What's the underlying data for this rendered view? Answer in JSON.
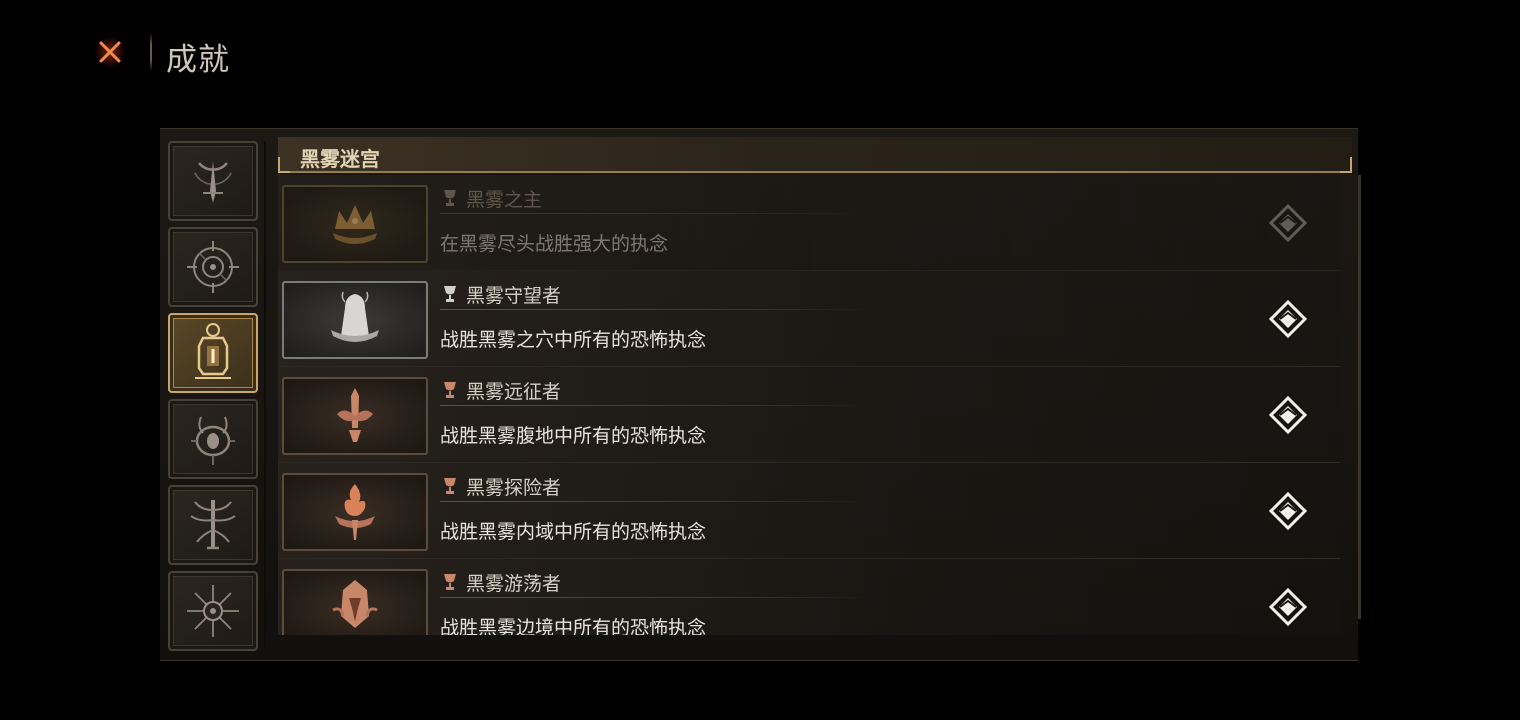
{
  "header": {
    "title": "成就",
    "close_icon": "close-x-icon"
  },
  "tabs": [
    {
      "icon": "crescent-blade-icon",
      "active": false
    },
    {
      "icon": "compass-sigil-icon",
      "active": false
    },
    {
      "icon": "lantern-icon",
      "active": true
    },
    {
      "icon": "horned-eye-icon",
      "active": false
    },
    {
      "icon": "tree-sigil-icon",
      "active": false
    },
    {
      "icon": "starburst-rune-icon",
      "active": false
    }
  ],
  "section": {
    "title": "黑雾迷宫"
  },
  "achievements": [
    {
      "name": "黑雾之主",
      "description": "在黑雾尽头战胜强大的执念",
      "badge_icon": "crown-flame-icon",
      "tier": "gold",
      "completed": false
    },
    {
      "name": "黑雾守望者",
      "description": "战胜黑雾之穴中所有的恐怖执念",
      "badge_icon": "hooded-figure-icon",
      "tier": "silver",
      "completed": true
    },
    {
      "name": "黑雾远征者",
      "description": "战胜黑雾腹地中所有的恐怖执念",
      "badge_icon": "sword-emblem-icon",
      "tier": "bronze",
      "completed": true
    },
    {
      "name": "黑雾探险者",
      "description": "战胜黑雾内域中所有的恐怖执念",
      "badge_icon": "torch-flame-icon",
      "tier": "bronze",
      "completed": true
    },
    {
      "name": "黑雾游荡者",
      "description": "战胜黑雾边境中所有的恐怖执念",
      "badge_icon": "hooded-mask-icon",
      "tier": "bronze",
      "completed": true
    }
  ],
  "colors": {
    "gold": "#c8a56b",
    "bronze": "#c9876a",
    "silver": "#d0cfcc",
    "accent_close": "#e0642a"
  }
}
